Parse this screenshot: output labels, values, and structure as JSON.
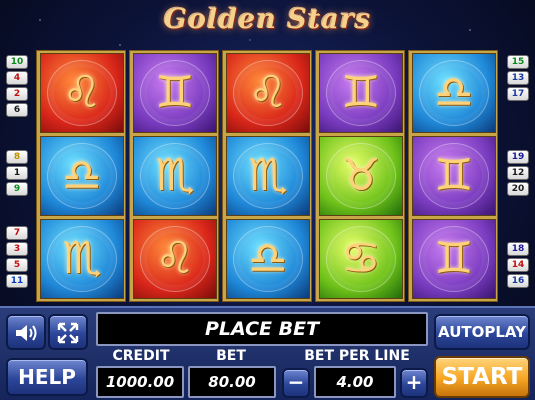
{
  "title": "Golden Stars",
  "paylines": {
    "left": [
      "10",
      "4",
      "2",
      "6",
      "8",
      "1",
      "9",
      "7",
      "3",
      "5",
      "11"
    ],
    "right": [
      "15",
      "13",
      "17",
      "19",
      "12",
      "20",
      "18",
      "14",
      "16"
    ],
    "colors": {
      "10": "#0a8a1a",
      "4": "#c01010",
      "2": "#c01010",
      "6": "#1a1a1a",
      "8": "#c09000",
      "1": "#1a1a1a",
      "9": "#0a8a1a",
      "7": "#c01010",
      "3": "#c01010",
      "5": "#c01010",
      "11": "#0a3ac0",
      "15": "#0a8a1a",
      "13": "#1a3aa0",
      "17": "#1a3aa0",
      "19": "#1a1a9a",
      "12": "#1a1a1a",
      "20": "#1a1a1a",
      "18": "#1a1a9a",
      "14": "#c01010",
      "16": "#1a3aa0"
    }
  },
  "reels": [
    [
      {
        "symbol": "leo-icon",
        "glyph": "♌",
        "bg": "red"
      },
      {
        "symbol": "libra-icon",
        "glyph": "♎",
        "bg": "blue"
      },
      {
        "symbol": "scorpio-icon",
        "glyph": "♏",
        "bg": "blue"
      }
    ],
    [
      {
        "symbol": "gemini-icon",
        "glyph": "♊",
        "bg": "purple"
      },
      {
        "symbol": "scorpio-icon",
        "glyph": "♏",
        "bg": "blue"
      },
      {
        "symbol": "leo-icon",
        "glyph": "♌",
        "bg": "red"
      }
    ],
    [
      {
        "symbol": "leo-icon",
        "glyph": "♌",
        "bg": "red"
      },
      {
        "symbol": "scorpio-icon",
        "glyph": "♏",
        "bg": "blue"
      },
      {
        "symbol": "libra-icon",
        "glyph": "♎",
        "bg": "blue"
      }
    ],
    [
      {
        "symbol": "gemini-icon",
        "glyph": "♊",
        "bg": "purple"
      },
      {
        "symbol": "taurus-icon",
        "glyph": "♉",
        "bg": "green"
      },
      {
        "symbol": "cancer-icon",
        "glyph": "♋",
        "bg": "green"
      }
    ],
    [
      {
        "symbol": "libra-icon",
        "glyph": "♎",
        "bg": "blue"
      },
      {
        "symbol": "gemini-icon",
        "glyph": "♊",
        "bg": "purple"
      },
      {
        "symbol": "gemini-icon",
        "glyph": "♊",
        "bg": "purple"
      }
    ]
  ],
  "controls": {
    "sound_icon": "speaker-icon",
    "fullscreen_icon": "fullscreen-arrows-icon",
    "help_label": "HELP",
    "message": "PLACE BET",
    "autoplay_label": "AUTOPLAY",
    "start_label": "START",
    "credit_label": "CREDIT",
    "credit_value": "1000.00",
    "bet_label": "BET",
    "bet_value": "80.00",
    "bet_per_line_label": "BET PER LINE",
    "bet_per_line_value": "4.00",
    "minus_label": "−",
    "plus_label": "+"
  },
  "colors": {
    "accent_gold": "#c9a54a",
    "panel_blue": "#2a3d7a",
    "start_orange": "#f5a623"
  }
}
